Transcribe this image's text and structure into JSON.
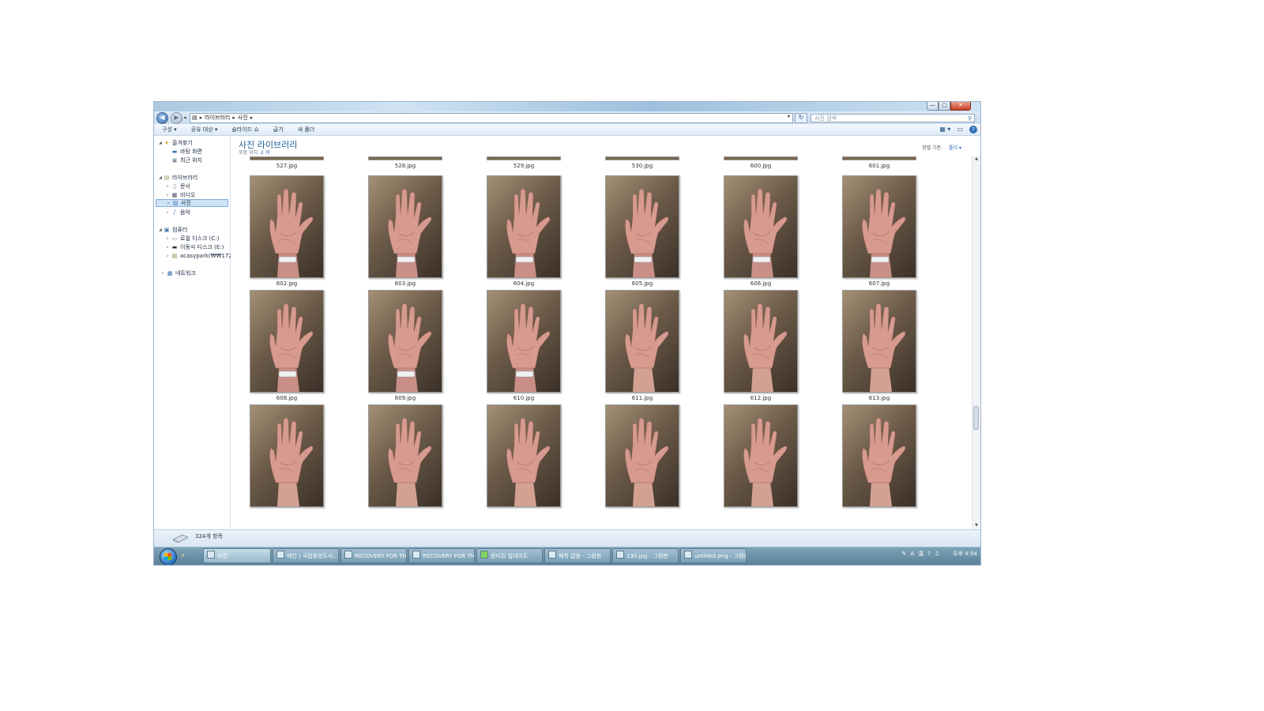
{
  "window": {
    "controls": {
      "minimize": "—",
      "maximize": "□",
      "close": "✕"
    }
  },
  "address": {
    "back_label": "◀",
    "forward_label": "▶",
    "history_label": "▾",
    "crumbs": [
      "라이브러리",
      "사진"
    ],
    "search_placeholder": "사진 검색"
  },
  "toolbar": {
    "items": [
      "구성 ▾",
      "공유 대상 ▾",
      "슬라이드 쇼",
      "굽기",
      "새 폴더"
    ]
  },
  "nav": {
    "favorites": {
      "label": "즐겨찾기",
      "items": [
        "바탕 화면",
        "최근 위치"
      ]
    },
    "libraries": {
      "label": "라이브러리",
      "items": [
        "문서",
        "비디오",
        "사진",
        "음악"
      ]
    },
    "computer": {
      "label": "컴퓨터",
      "items": [
        "로컬 디스크 (C:)",
        "이동식 디스크 (E:)",
        "acasypark(₩₩172.2"
      ]
    },
    "network": {
      "label": "네트워크"
    },
    "selected": "사진"
  },
  "content": {
    "title": "사진 라이브러리",
    "subtitle_prefix": "포함 위치:",
    "subtitle_link": "2 개",
    "arrange_label": "정렬 기준:",
    "arrange_value": "폴더 ▾"
  },
  "top_row_labels": [
    "527.jpg",
    "528.jpg",
    "529.jpg",
    "530.jpg",
    "600.jpg",
    "601.jpg"
  ],
  "files": [
    {
      "name": "602.jpg",
      "bracelet": true
    },
    {
      "name": "603.jpg",
      "bracelet": true
    },
    {
      "name": "604.jpg",
      "bracelet": true
    },
    {
      "name": "605.jpg",
      "bracelet": true
    },
    {
      "name": "606.jpg",
      "bracelet": true
    },
    {
      "name": "607.jpg",
      "bracelet": true
    },
    {
      "name": "608.jpg",
      "bracelet": true
    },
    {
      "name": "609.jpg",
      "bracelet": true
    },
    {
      "name": "610.jpg",
      "bracelet": true
    },
    {
      "name": "611.jpg",
      "bracelet": false
    },
    {
      "name": "612.jpg",
      "bracelet": false
    },
    {
      "name": "613.jpg",
      "bracelet": false
    },
    {
      "name": "",
      "bracelet": false
    },
    {
      "name": "",
      "bracelet": false
    },
    {
      "name": "",
      "bracelet": false
    },
    {
      "name": "",
      "bracelet": false
    },
    {
      "name": "",
      "bracelet": false
    },
    {
      "name": "",
      "bracelet": false
    }
  ],
  "status": {
    "item_count": "324개 항목"
  },
  "taskbar": {
    "tasks": [
      "사진",
      "메인 | 국립중앙도서...",
      "RECOVERY FOR THE...",
      "RECOVERY FOR THE...",
      "윈디킹 업데이트",
      "제목 없음 - 그림판",
      "130.jpg - 그림판",
      "untitled.png - 그림판"
    ],
    "tray": {
      "ime_a": "A",
      "ime_han": "漢",
      "help": "?"
    },
    "clock": "오후 4:54"
  },
  "colors": {
    "title_blue": "#1e5b8f",
    "link_blue": "#2a66b0",
    "taskbar": "#6b92a9",
    "selection": "#cde4f8"
  }
}
